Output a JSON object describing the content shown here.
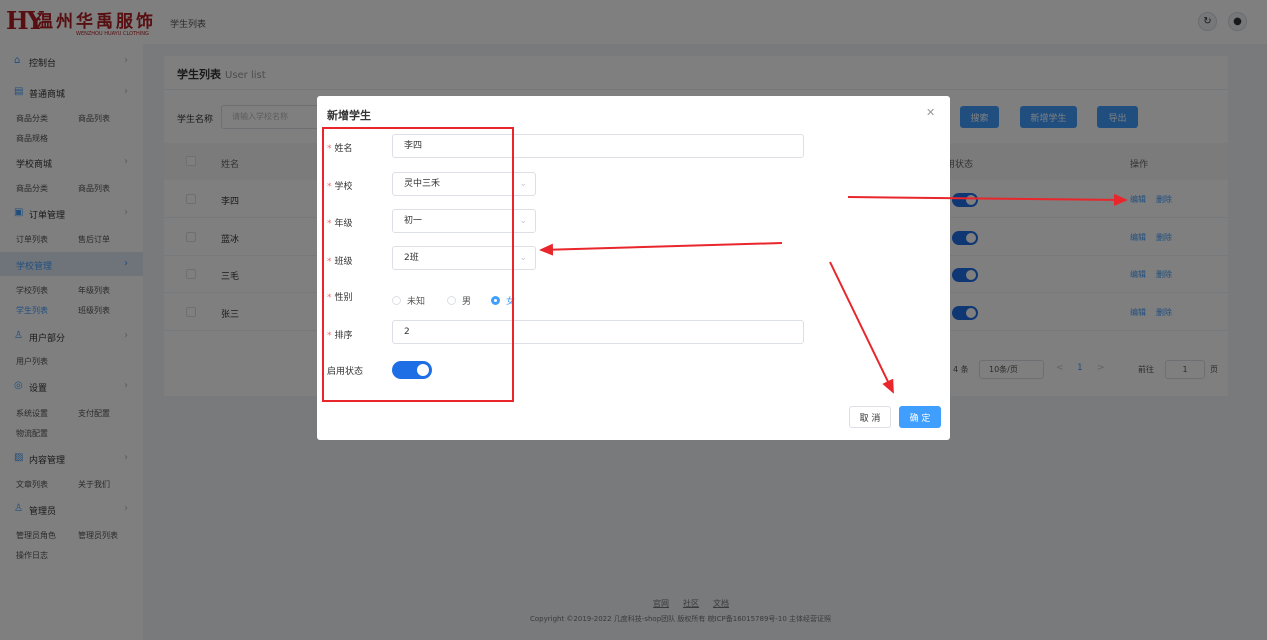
{
  "header": {
    "logo_mark": "HY",
    "logo_cn": "温州华禹服饰",
    "logo_en": "WENZHOU HUAYU CLOTHING",
    "page_title": "学生列表",
    "refresh_icon": "refresh-icon",
    "user_icon": "user-avatar-icon"
  },
  "sidebar": {
    "dashboard": "控制台",
    "general_mall": "普通商城",
    "general_sub": [
      "商品分类",
      "商品列表",
      "商品规格"
    ],
    "school_mall": "学校商城",
    "school_mall_sub": [
      "商品分类",
      "商品列表"
    ],
    "orders": "订单管理",
    "orders_sub": [
      "订单列表",
      "售后订单"
    ],
    "school_mgmt": "学校管理",
    "school_sub": [
      "学校列表",
      "年级列表",
      "学生列表",
      "班级列表"
    ],
    "users": "用户部分",
    "users_sub": [
      "用户列表"
    ],
    "settings": "设置",
    "settings_sub": [
      "系统设置",
      "支付配置",
      "物流配置"
    ],
    "content": "内容管理",
    "content_sub": [
      "文章列表",
      "关于我们"
    ],
    "admin": "管理员",
    "admin_sub": [
      "管理员角色",
      "管理员列表",
      "操作日志"
    ]
  },
  "main": {
    "title": "学生列表",
    "title_en": "User list",
    "filter_label": "学生名称",
    "filter_placeholder": "请输入学校名称",
    "search_button": "搜索",
    "add_button": "新增学生",
    "export_button": "导出",
    "columns": {
      "name": "姓名",
      "status": "用状态",
      "actions": "操作"
    },
    "rows": [
      {
        "name": "李四",
        "enabled": true
      },
      {
        "name": "蓝冰",
        "enabled": true
      },
      {
        "name": "三毛",
        "enabled": true
      },
      {
        "name": "张三",
        "enabled": true
      }
    ],
    "edit_label": "编辑",
    "delete_label": "删除",
    "pagination": {
      "total": "4 条",
      "page_size": "10条/页",
      "prev": "<",
      "current": "1",
      "next": ">",
      "goto_label": "前往",
      "goto_value": "1",
      "page_unit": "页"
    }
  },
  "footer": {
    "links": [
      "官网",
      "社区",
      "文档"
    ],
    "copyright": "Copyright ©2019-2022 几度科技-shop团队 版权所有 皖ICP备16015789号-10 主体经营证照"
  },
  "modal": {
    "title": "新增学生",
    "close_icon": "close-icon",
    "fields": {
      "name_label": "姓名",
      "name_value": "李四",
      "school_label": "学校",
      "school_value": "灵中三禾",
      "grade_label": "年级",
      "grade_value": "初一",
      "class_label": "班级",
      "class_value": "2班",
      "gender_label": "性别",
      "gender_options": [
        "未知",
        "男",
        "女"
      ],
      "gender_selected": "女",
      "sort_label": "排序",
      "sort_value": "2",
      "status_label": "启用状态",
      "status_enabled": true
    },
    "cancel_button": "取 消",
    "confirm_button": "确 定"
  },
  "colors": {
    "primary": "#409eff",
    "switch": "#1e6fe6",
    "brand": "#b01e24",
    "annotation": "#e8262b",
    "required": "#f56c6c"
  }
}
